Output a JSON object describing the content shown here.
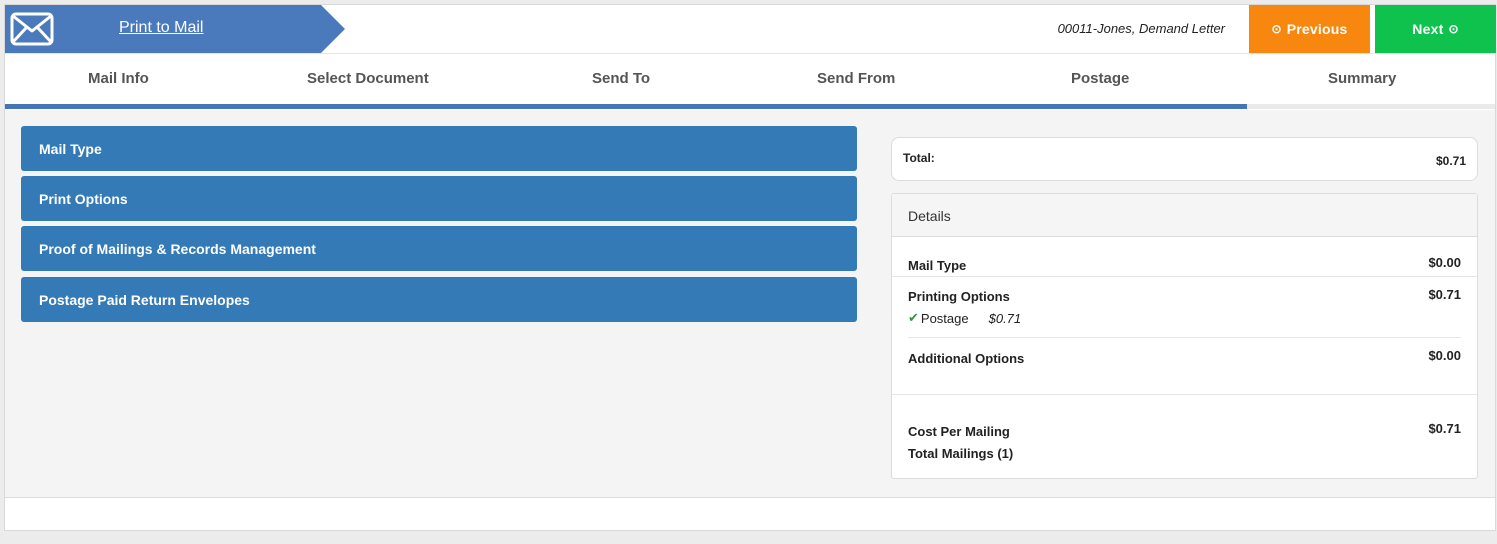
{
  "header": {
    "title": "Print to Mail",
    "matter": "00011-Jones, Demand Letter",
    "previous_label": "Previous",
    "next_label": "Next",
    "previous_color": "#f7870f",
    "next_color": "#0fc14d",
    "banner_color": "#4a79bc"
  },
  "tabs": [
    {
      "label": "Mail Info"
    },
    {
      "label": "Select Document"
    },
    {
      "label": "Send To"
    },
    {
      "label": "Send From"
    },
    {
      "label": "Postage"
    },
    {
      "label": "Summary"
    }
  ],
  "progress": {
    "completed_steps": 5,
    "total_steps": 6
  },
  "sections": [
    {
      "label": "Mail Type"
    },
    {
      "label": "Print Options"
    },
    {
      "label": "Proof of Mailings & Records Management"
    },
    {
      "label": "Postage Paid Return Envelopes"
    }
  ],
  "summary": {
    "total_label": "Total:",
    "total_value": "$0.71",
    "details_title": "Details",
    "mail_type_label": "Mail Type",
    "mail_type_value": "$0.00",
    "printing_label": "Printing Options",
    "printing_value": "$0.71",
    "postage_label": "Postage",
    "postage_value": "$0.71",
    "additional_label": "Additional Options",
    "additional_value": "$0.00",
    "cost_label": "Cost Per Mailing",
    "cost_value": "$0.71",
    "mailings_label": "Total Mailings (1)"
  }
}
